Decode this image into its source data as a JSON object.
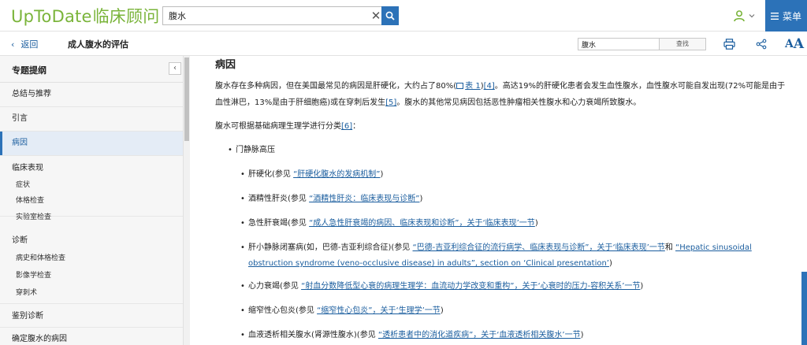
{
  "brand": {
    "logo_en": "UpToDate",
    "logo_cn": "临床顾问"
  },
  "search": {
    "value": "腹水"
  },
  "header": {
    "menu_label": "菜单"
  },
  "subbar": {
    "back_label": "返回",
    "topic_title": "成人腹水的评估",
    "find_value": "腹水",
    "find_button": "查找"
  },
  "sidebar": {
    "title": "专题提纲",
    "items": [
      {
        "label": "总结与推荐"
      },
      {
        "label": "引言"
      },
      {
        "label": "病因"
      },
      {
        "label": "临床表现"
      },
      {
        "label": "症状"
      },
      {
        "label": "体格检查"
      },
      {
        "label": "实验室检查"
      },
      {
        "label": "诊断"
      },
      {
        "label": "病史和体格检查"
      },
      {
        "label": "影像学检查"
      },
      {
        "label": "穿刺术"
      },
      {
        "label": "鉴别诊断"
      },
      {
        "label": "确定腹水的病因"
      }
    ]
  },
  "content": {
    "section_title": "病因",
    "p1": {
      "a": "腹水存在多种病因，但在美国最常见的病因是肝硬化，大约占了80%(",
      "table_link": "表 1",
      "b": ")",
      "ref1": "[4]",
      "c": "。高达19%的肝硬化患者会发生血性腹水，血性腹水可能自发出现(72%可能是由于血性淋巴，13%是由于肝细胞癌)或在穿刺后发生",
      "ref2": "[5]",
      "d": "。腹水的其他常见病因包括恶性肿瘤相关性腹水和心力衰竭所致腹水。"
    },
    "p2": {
      "a": "腹水可根据基础病理生理学进行分类",
      "ref": "[6]",
      "b": "："
    },
    "bullet_portal": "门静脉高压",
    "sub_bullets": [
      {
        "pre": "肝硬化(参见 ",
        "link": "“肝硬化腹水的发病机制”",
        "post": ")"
      },
      {
        "pre": "酒精性肝炎(参见 ",
        "link": "“酒精性肝炎：临床表现与诊断”",
        "post": ")"
      },
      {
        "pre": "急性肝衰竭(参见 ",
        "link": "“成人急性肝衰竭的病因、临床表现和诊断”，关于‘临床表现’一节",
        "post": ")"
      },
      {
        "pre": "肝小静脉闭塞病(如，巴德-吉亚利综合征)(参见 ",
        "link": "“巴德-吉亚利综合征的流行病学、临床表现与诊断”，关于‘临床表现’一节",
        "mid": "和 ",
        "link2": "“Hepatic sinusoidal obstruction syndrome (veno-occlusive disease) in adults”, section on ‘Clinical presentation’",
        "post": ")"
      },
      {
        "pre": "心力衰竭(参见 ",
        "link": "“射血分数降低型心衰的病理生理学：血流动力学改变和重构”，关于‘心衰时的压力-容积关系’一节",
        "post": ")"
      },
      {
        "pre": "缩窄性心包炎(参见 ",
        "link": "“缩窄性心包炎”，关于‘生理学’一节",
        "post": ")"
      },
      {
        "pre": "血液透析相关腹水(肾源性腹水)(参见 ",
        "link": "“透析患者中的消化道疾病”，关于‘血液透析相关腹水’一节",
        "post": ")"
      }
    ]
  }
}
